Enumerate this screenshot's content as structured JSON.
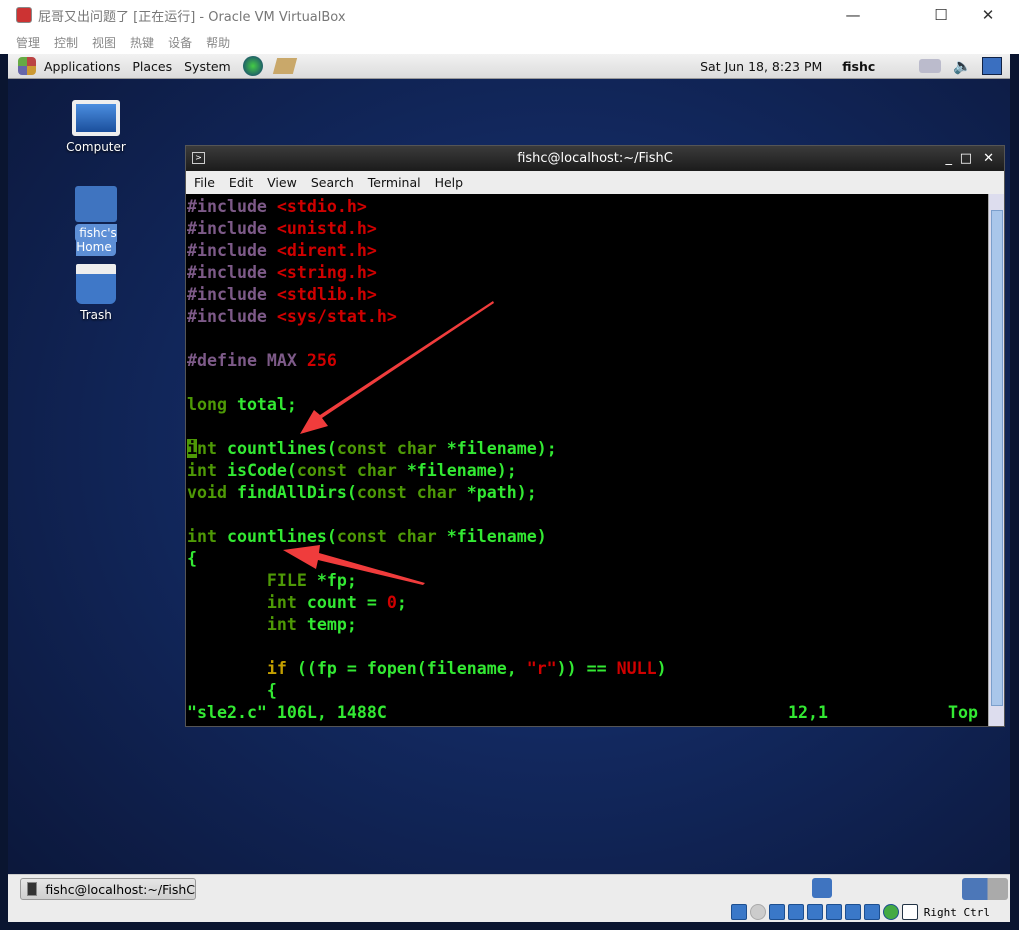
{
  "host": {
    "title": "屁哥又出问题了 [正在运行] - Oracle VM VirtualBox",
    "menu": [
      "管理",
      "控制",
      "视图",
      "热键",
      "设备",
      "帮助"
    ],
    "status_key": "Right Ctrl"
  },
  "panel": {
    "menu": [
      "Applications",
      "Places",
      "System"
    ],
    "clock": "Sat Jun 18,  8:23 PM",
    "user": "fishc"
  },
  "desktop": {
    "icons": [
      "Computer",
      "fishc's Home",
      "Trash"
    ]
  },
  "taskbar": {
    "window": "fishc@localhost:~/FishC"
  },
  "terminal": {
    "title": "fishc@localhost:~/FishC",
    "menu": [
      "File",
      "Edit",
      "View",
      "Search",
      "Terminal",
      "Help"
    ],
    "lines": [
      [
        [
          "#include ",
          "pp"
        ],
        [
          "<stdio.h>",
          "str"
        ]
      ],
      [
        [
          "#include ",
          "pp"
        ],
        [
          "<unistd.h>",
          "str"
        ]
      ],
      [
        [
          "#include ",
          "pp"
        ],
        [
          "<dirent.h>",
          "str"
        ]
      ],
      [
        [
          "#include ",
          "pp"
        ],
        [
          "<string.h>",
          "str"
        ]
      ],
      [
        [
          "#include ",
          "pp"
        ],
        [
          "<stdlib.h>",
          "str"
        ]
      ],
      [
        [
          "#include ",
          "pp"
        ],
        [
          "<sys/stat.h>",
          "str"
        ]
      ],
      [],
      [
        [
          "#define MAX ",
          "pp"
        ],
        [
          "256",
          "str"
        ]
      ],
      [],
      [
        [
          "long ",
          "ty"
        ],
        [
          "total;",
          "fn"
        ]
      ],
      [],
      [
        [
          "i",
          "cur"
        ],
        [
          "nt ",
          "ty"
        ],
        [
          "countlines(",
          "fn"
        ],
        [
          "const char ",
          "ty"
        ],
        [
          "*filename);",
          "fn"
        ]
      ],
      [
        [
          "int ",
          "ty"
        ],
        [
          "isCode(",
          "fn"
        ],
        [
          "const char ",
          "ty"
        ],
        [
          "*filename);",
          "fn"
        ]
      ],
      [
        [
          "void ",
          "ty"
        ],
        [
          "findAllDirs(",
          "fn"
        ],
        [
          "const char ",
          "ty"
        ],
        [
          "*path);",
          "fn"
        ]
      ],
      [],
      [
        [
          "int ",
          "ty"
        ],
        [
          "countlines(",
          "fn"
        ],
        [
          "const char ",
          "ty"
        ],
        [
          "*filename)",
          "fn"
        ]
      ],
      [
        [
          "{",
          "fn"
        ]
      ],
      [
        [
          "        FILE ",
          "ty"
        ],
        [
          "*fp;",
          "fn"
        ]
      ],
      [
        [
          "        int ",
          "ty"
        ],
        [
          "count = ",
          "fn"
        ],
        [
          "0",
          "str"
        ],
        [
          ";",
          "fn"
        ]
      ],
      [
        [
          "        int ",
          "ty"
        ],
        [
          "temp;",
          "fn"
        ]
      ],
      [],
      [
        [
          "        if ",
          "kw"
        ],
        [
          "((fp = fopen(filename, ",
          "fn"
        ],
        [
          "\"r\"",
          "str"
        ],
        [
          ")) == ",
          "fn"
        ],
        [
          "NULL",
          "str"
        ],
        [
          ")",
          "fn"
        ]
      ],
      [
        [
          "        {",
          "fn"
        ]
      ]
    ],
    "status_left": "\"sle2.c\" 106L, 1488C",
    "status_pos": "12,1",
    "status_right": "Top"
  },
  "colors": {
    "preprocessor": "#7d5a88",
    "string": "#d00000",
    "identifier": "#33e933",
    "type": "#4e9a06",
    "keyword": "#c4a000",
    "arrow": "#f03c3c"
  }
}
